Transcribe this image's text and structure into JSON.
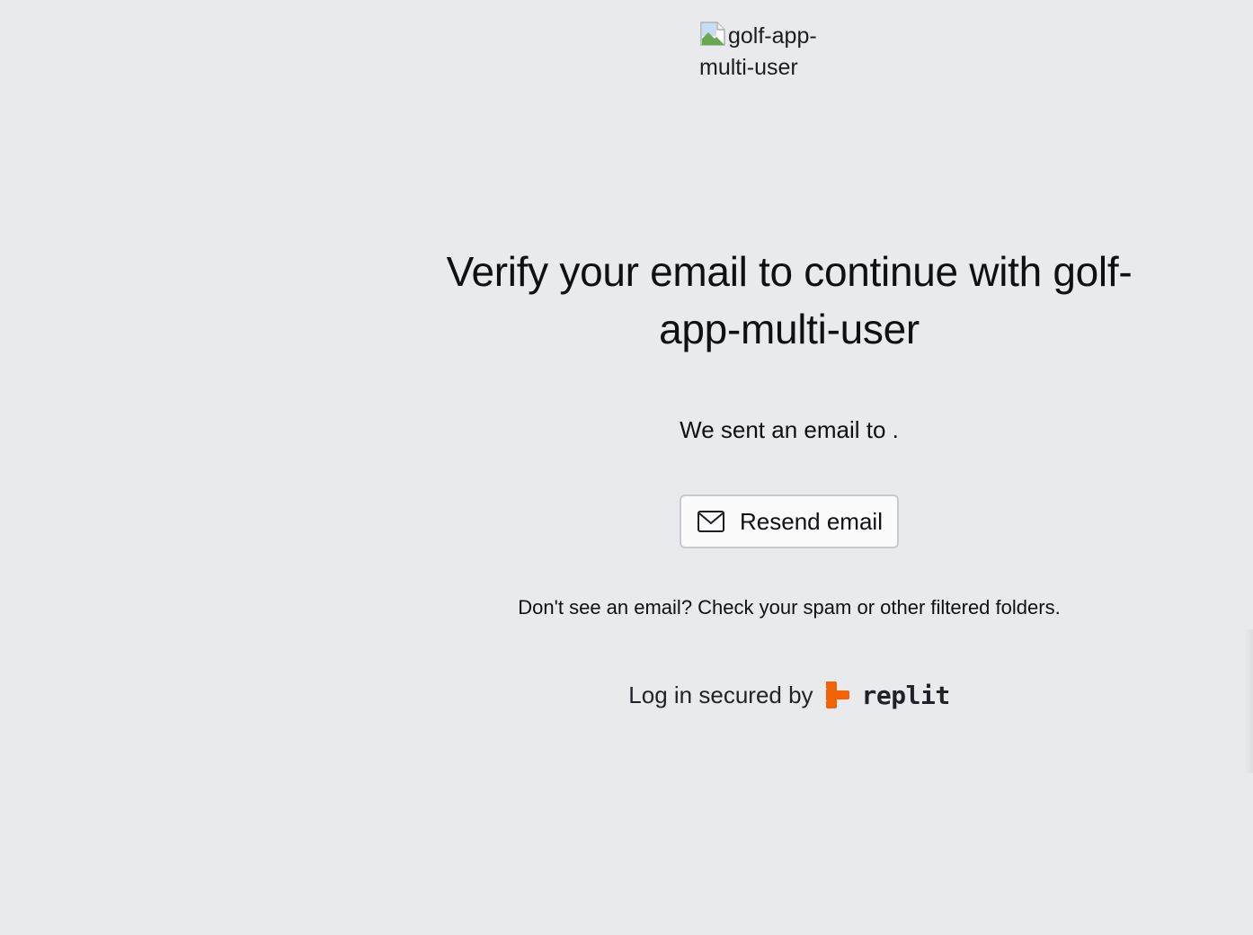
{
  "logo": {
    "alt_text": "golf-app-multi-user"
  },
  "title": "Verify your email to continue with golf-app-multi-user",
  "sent_message": "We sent an email to .",
  "resend_button": {
    "label": "Resend email",
    "icon": "mail-icon"
  },
  "hint": "Don't see an email? Check your spam or other filtered folders.",
  "secured": {
    "label": "Log in secured by",
    "brand": "replit",
    "brand_color": "#f26207"
  }
}
